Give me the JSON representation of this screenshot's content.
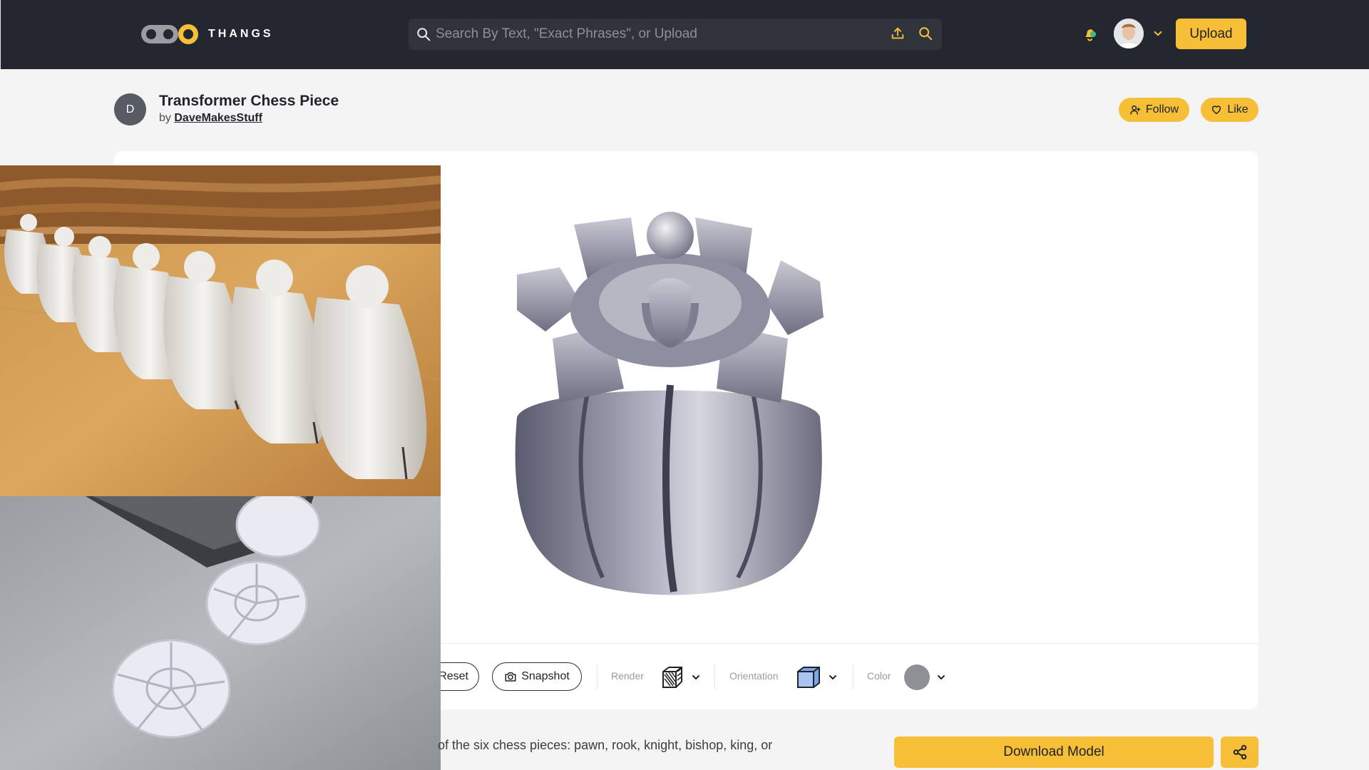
{
  "header": {
    "logo_text": "THANGS",
    "search_placeholder": "Search By Text, \"Exact Phrases\", or Upload",
    "upload_label": "Upload",
    "icons": [
      "search-icon",
      "upload-icon",
      "search-submit-icon",
      "notification-icon",
      "chevron-down-icon"
    ]
  },
  "model": {
    "author_initial": "D",
    "title": "Transformer Chess Piece",
    "by_prefix": "by",
    "author": "DaveMakesStuff",
    "follow_label": "Follow",
    "like_label": "Like"
  },
  "viewer": {
    "reset_label": "Reset",
    "snapshot_label": "Snapshot",
    "render_label": "Render",
    "orientation_label": "Orientation",
    "color_label": "Color",
    "model_color": "#8f9094"
  },
  "bottom": {
    "description": "of the six chess pieces: pawn, rook, knight, bishop, king, or",
    "download_label": "Download Model"
  },
  "colors": {
    "topbar": "#232730",
    "accent": "#f7be38",
    "background": "#f4f4f4"
  }
}
